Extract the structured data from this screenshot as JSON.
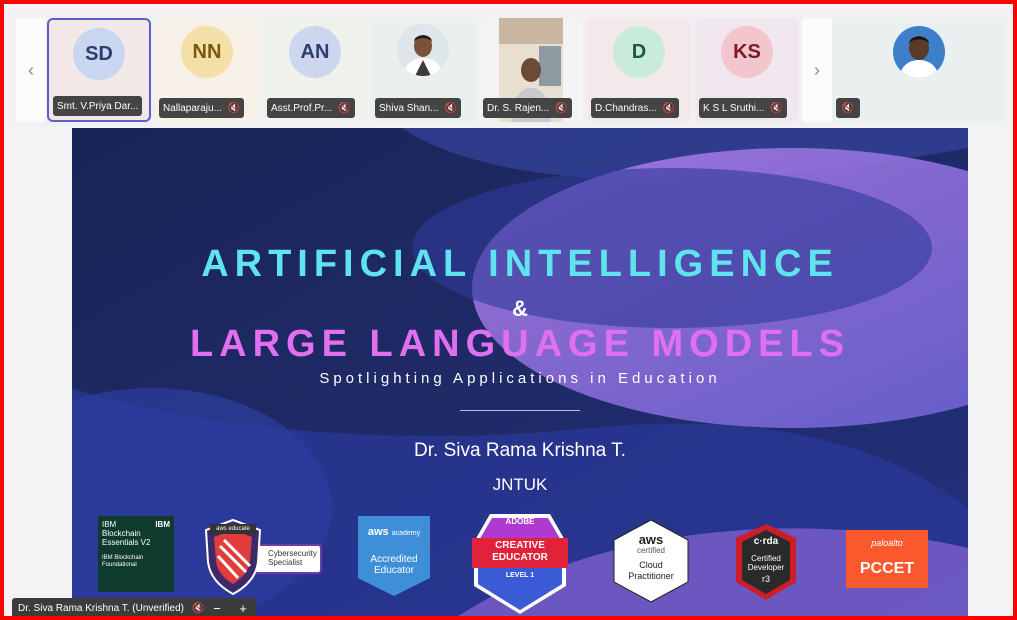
{
  "participants": [
    {
      "initials": "SD",
      "name": "Smt. V.Priya Dar...",
      "bg": "#f3e8e8",
      "avatar_bg": "#c9d6f0",
      "avatar_fg": "#2c3e6e",
      "type": "initials"
    },
    {
      "initials": "NN",
      "name": "Nallaparaju...",
      "bg": "#f6f0e6",
      "avatar_bg": "#f5dfa8",
      "avatar_fg": "#7a5a08",
      "type": "initials"
    },
    {
      "initials": "AN",
      "name": "Asst.Prof.Pr...",
      "bg": "#eef2ea",
      "avatar_bg": "#cdd6ef",
      "avatar_fg": "#2c3e6e",
      "type": "initials"
    },
    {
      "initials": "",
      "name": "Shiva Shan...",
      "bg": "#eaf0ee",
      "type": "photo"
    },
    {
      "initials": "",
      "name": "Dr. S. Rajen...",
      "bg": "#e6d9c9",
      "type": "video"
    },
    {
      "initials": "D",
      "name": "D.Chandras...",
      "bg": "#f3e8ea",
      "avatar_bg": "#c8ecd9",
      "avatar_fg": "#1d5a3a",
      "type": "initials"
    },
    {
      "initials": "KS",
      "name": "K S L Sruthi...",
      "bg": "#f1e7ef",
      "avatar_bg": "#f2c6cc",
      "avatar_fg": "#7a1a24",
      "type": "initials"
    },
    {
      "initials": "",
      "name": "",
      "bg": "#eaf0ef",
      "type": "photo"
    }
  ],
  "nav": {
    "prev": "‹",
    "next": "›"
  },
  "slide": {
    "title_line1": "ARTIFICIAL INTELLIGENCE",
    "ampersand": "&",
    "title_line2": "LARGE LANGUAGE MODELS",
    "subtitle": "Spotlighting Applications in Education",
    "presenter": "Dr. Siva Rama Krishna T.",
    "organization": "JNTUK",
    "badges": {
      "ibm": {
        "line1": "IBM",
        "line2": "Blockchain",
        "line3": "Essentials V2",
        "line4": "IBM Blockchain",
        "line5": "Foundational",
        "brand": "IBM"
      },
      "cyber": {
        "brand": "aws educate",
        "text1": "Cybersecurity",
        "text2": "Specialist"
      },
      "aws_academy": {
        "brand": "aws",
        "brand2": "academy",
        "text1": "Accredited",
        "text2": "Educator"
      },
      "adobe": {
        "brand": "ADOBE",
        "text1": "CREATIVE",
        "text2": "EDUCATOR",
        "level": "LEVEL 1"
      },
      "aws_cloud": {
        "brand": "aws",
        "certified": "certified",
        "text1": "Cloud",
        "text2": "Practitioner"
      },
      "corda": {
        "brand": "c·rda",
        "text1": "Certified",
        "text2": "Developer",
        "mark": "r3"
      },
      "palo": {
        "brand": "paloalto",
        "text": "PCCET"
      }
    }
  },
  "presenter_tag": {
    "label": "Dr. Siva Rama Krishna T. (Unverified)"
  },
  "zoom": {
    "minus": "−",
    "plus": "+"
  }
}
